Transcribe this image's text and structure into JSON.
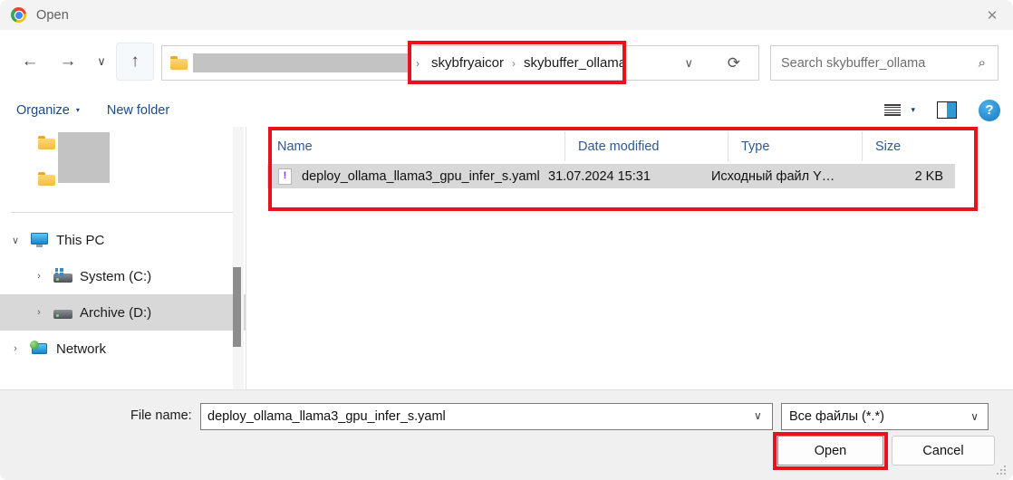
{
  "window": {
    "title": "Open",
    "app_icon": "chrome-logo-icon",
    "close_label": "✕"
  },
  "nav": {
    "back_icon": "←",
    "forward_icon": "→",
    "recent_icon": "∨",
    "up_icon": "↑"
  },
  "address": {
    "folder_icon": "folder-icon",
    "redacted_segment": "",
    "separator": "›",
    "crumbs": [
      "skybfryaicor",
      "skybuffer_ollama"
    ],
    "dropdown_icon": "∨",
    "refresh_icon": "⟳"
  },
  "search": {
    "placeholder": "Search skybuffer_ollama",
    "value": "",
    "icon": "⌕"
  },
  "toolbar": {
    "organize_label": "Organize",
    "organize_caret": "▾",
    "new_folder_label": "New folder",
    "view_caret": "▾",
    "help_label": "?"
  },
  "sidebar": {
    "items": [
      {
        "label": "This PC",
        "chevron": "∨",
        "icon": "monitor-icon",
        "selected": false
      },
      {
        "label": "System (C:)",
        "chevron": "›",
        "icon": "drive-icon",
        "selected": false
      },
      {
        "label": "Archive (D:)",
        "chevron": "›",
        "icon": "drive-icon",
        "selected": true
      },
      {
        "label": "Network",
        "chevron": "›",
        "icon": "network-icon",
        "selected": false
      }
    ]
  },
  "filelist": {
    "columns": [
      "Name",
      "Date modified",
      "Type",
      "Size"
    ],
    "rows": [
      {
        "icon": "yaml-file-icon",
        "icon_glyph": "!",
        "name": "deploy_ollama_llama3_gpu_infer_s.yaml",
        "date_modified": "31.07.2024 15:31",
        "type": "Исходный файл Y…",
        "size": "2 KB",
        "selected": true
      }
    ]
  },
  "bottom": {
    "filename_label": "File name:",
    "filename_value": "deploy_ollama_llama3_gpu_infer_s.yaml",
    "filename_caret": "∨",
    "filter_value": "Все файлы (*.*)",
    "filter_caret": "∨",
    "open_label": "Open",
    "cancel_label": "Cancel"
  },
  "annotations": {
    "color": "#e8121a",
    "boxes": [
      "breadcrumb",
      "file-list",
      "open-button"
    ]
  }
}
